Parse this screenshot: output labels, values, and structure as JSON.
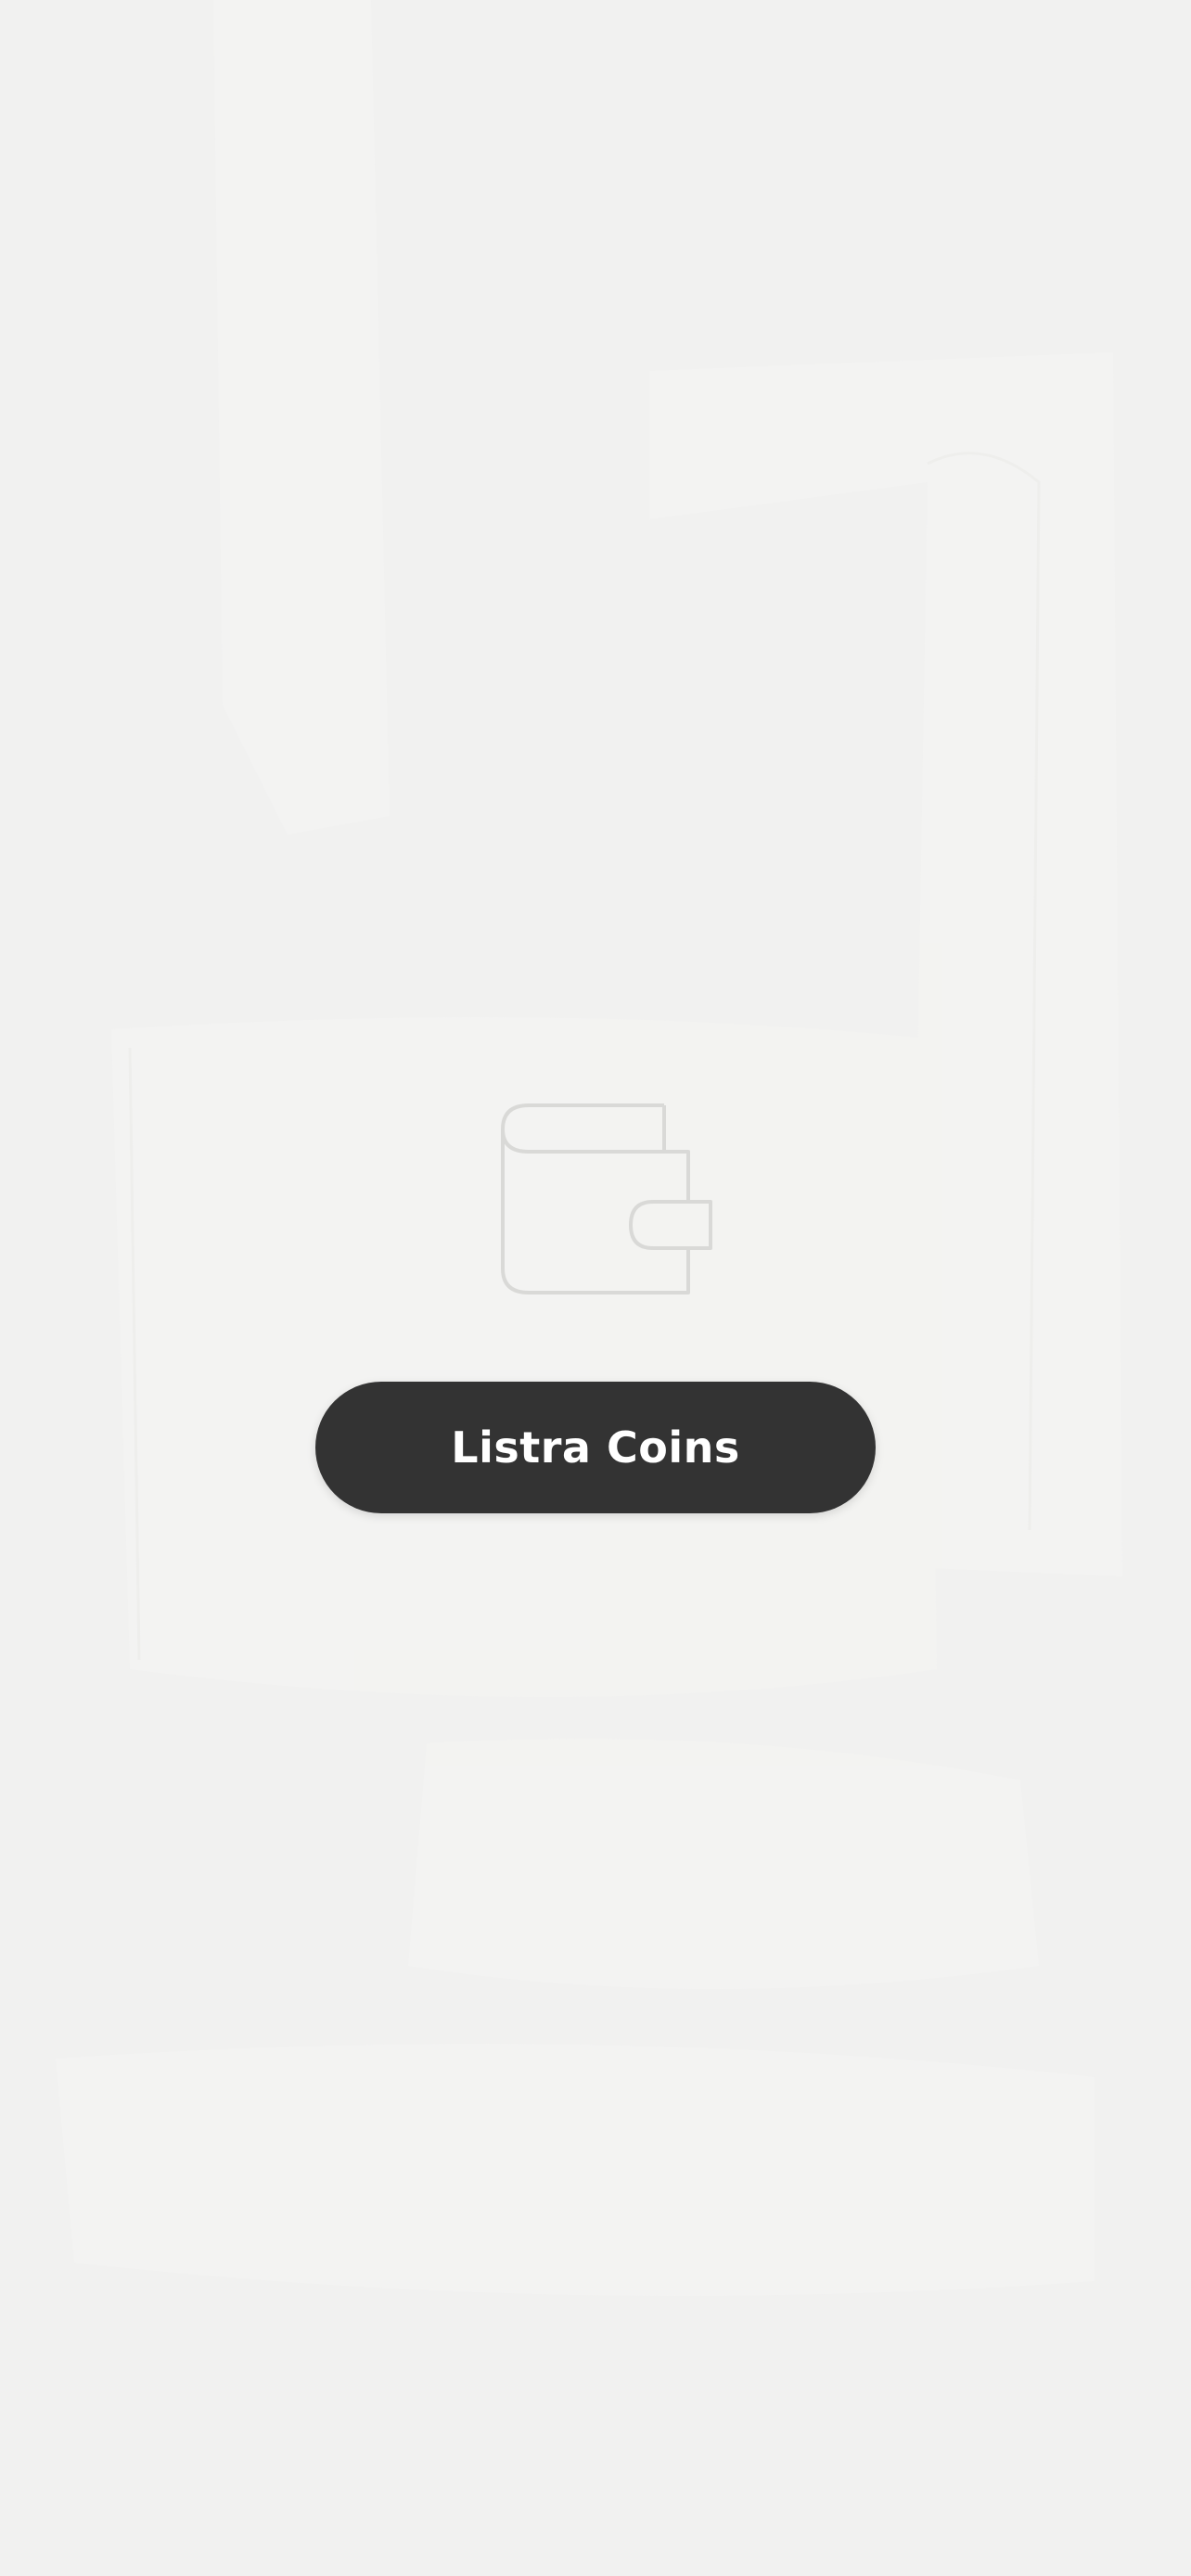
{
  "screen": {
    "background_color": "#f1f1f0",
    "background_art": "faint-abstract-shapes"
  },
  "hero": {
    "icon": "wallet-icon"
  },
  "cta": {
    "label": "Listra Coins",
    "background_color": "#333333",
    "text_color": "#ffffff"
  }
}
